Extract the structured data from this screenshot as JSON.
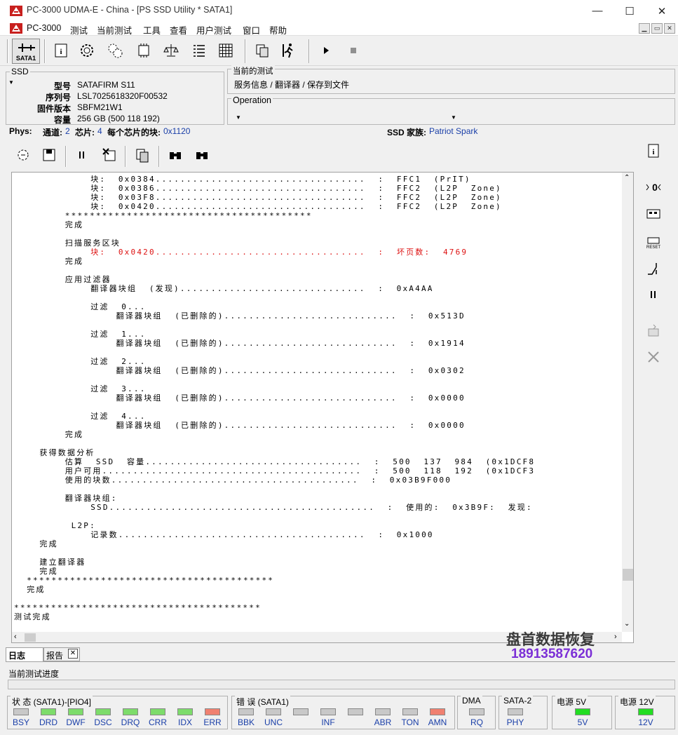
{
  "window": {
    "title": "PC-3000 UDMA-E - China - [PS SSD Utility * SATA1]",
    "minimize": "—",
    "maximize": "☐",
    "close": "✕"
  },
  "menu": {
    "items": [
      "PC-3000",
      "测试",
      "当前测试",
      "工具",
      "查看",
      "用户测试",
      "窗口",
      "帮助"
    ],
    "mdi": [
      "▁",
      "▭",
      "✕"
    ]
  },
  "toolbar": {
    "port_label": "SATA1",
    "icons": [
      "info-icon",
      "cog-icon",
      "cogs-icon",
      "chip-icon",
      "scales-icon",
      "list-icon",
      "grid-icon",
      "copy-icon",
      "walk-icon",
      "play-icon",
      "stop-icon"
    ]
  },
  "ssd": {
    "group_label": "SSD",
    "model_label": "型号",
    "model": "SATAFIRM   S11",
    "serial_label": "序列号",
    "serial": "LSL7025618320F00532",
    "firmware_label": "固件版本",
    "firmware": "SBFM21W1",
    "capacity_label": "容量",
    "capacity": "256 GB (500 118 192)"
  },
  "current_test": {
    "group_label": "当前的测试",
    "path": "服务信息 / 翻译器 / 保存到文件",
    "operation_label": "Operation"
  },
  "phys": {
    "label": "Phys:",
    "channels_label": "通道:",
    "channels": "2",
    "chips_label": "芯片:",
    "chips": "4",
    "blocks_label": "每个芯片的块:",
    "blocks": "0x1120",
    "family_label": "SSD 家族:",
    "family": "Patriot Spark"
  },
  "log": {
    "lines": [
      {
        "i": 6,
        "t": "块:  0x0384..................................  :  FFC1  (PrIT)"
      },
      {
        "i": 6,
        "t": "块:  0x0386..................................  :  FFC2  (L2P  Zone)"
      },
      {
        "i": 6,
        "t": "块:  0x03F8..................................  :  FFC2  (L2P  Zone)"
      },
      {
        "i": 6,
        "t": "块:  0x0420..................................  :  FFC2  (L2P  Zone)"
      },
      {
        "i": 4,
        "t": "****************************************"
      },
      {
        "i": 4,
        "t": "完成"
      },
      {
        "i": 0,
        "t": ""
      },
      {
        "i": 4,
        "t": "扫描服务区块"
      },
      {
        "i": 6,
        "t": "块:  0x0420..................................  :  坏页数:  4769",
        "red": true
      },
      {
        "i": 4,
        "t": "完成"
      },
      {
        "i": 0,
        "t": ""
      },
      {
        "i": 4,
        "t": "应用过滤器"
      },
      {
        "i": 6,
        "t": "翻译器块组  (发现)..............................  :  0xA4AA"
      },
      {
        "i": 0,
        "t": ""
      },
      {
        "i": 6,
        "t": "过滤  0..."
      },
      {
        "i": 8,
        "t": "翻译器块组  (已删除的)............................  :  0x513D"
      },
      {
        "i": 0,
        "t": ""
      },
      {
        "i": 6,
        "t": "过滤  1..."
      },
      {
        "i": 8,
        "t": "翻译器块组  (已删除的)............................  :  0x1914"
      },
      {
        "i": 0,
        "t": ""
      },
      {
        "i": 6,
        "t": "过滤  2..."
      },
      {
        "i": 8,
        "t": "翻译器块组  (已删除的)............................  :  0x0302"
      },
      {
        "i": 0,
        "t": ""
      },
      {
        "i": 6,
        "t": "过滤  3..."
      },
      {
        "i": 8,
        "t": "翻译器块组  (已删除的)............................  :  0x0000"
      },
      {
        "i": 0,
        "t": ""
      },
      {
        "i": 6,
        "t": "过滤  4..."
      },
      {
        "i": 8,
        "t": "翻译器块组  (已删除的)............................  :  0x0000"
      },
      {
        "i": 4,
        "t": "完成"
      },
      {
        "i": 0,
        "t": ""
      },
      {
        "i": 2,
        "t": "获得数据分析"
      },
      {
        "i": 4,
        "t": "估算  SSD  容量...................................  :  500  137  984  (0x1DCF8"
      },
      {
        "i": 4,
        "t": "用户可用..........................................  :  500  118  192  (0x1DCF3"
      },
      {
        "i": 4,
        "t": "使用的块数........................................  :  0x03B9F000"
      },
      {
        "i": 0,
        "t": ""
      },
      {
        "i": 4,
        "t": "翻译器块组:"
      },
      {
        "i": 6,
        "t": "SSD...........................................  :  使用的:  0x3B9F:  发现:"
      },
      {
        "i": 0,
        "t": ""
      },
      {
        "i": 4,
        "t": " L2P:"
      },
      {
        "i": 6,
        "t": "记录数........................................  :  0x1000"
      },
      {
        "i": 2,
        "t": "完成"
      },
      {
        "i": 0,
        "t": ""
      },
      {
        "i": 2,
        "t": "建立翻译器"
      },
      {
        "i": 2,
        "t": "完成"
      },
      {
        "i": 1,
        "t": "****************************************"
      },
      {
        "i": 1,
        "t": "完成"
      },
      {
        "i": 0,
        "t": ""
      },
      {
        "i": 0,
        "t": "****************************************"
      },
      {
        "i": 0,
        "t": "测试完成"
      }
    ]
  },
  "watermark": {
    "name": "盘首数据恢复",
    "phone": "18913587620"
  },
  "tabs": {
    "log": "日志",
    "report": "报告"
  },
  "progress": {
    "label": "当前测试进度"
  },
  "status": {
    "state_title": "状 态 (SATA1)-[PIO4]",
    "state_leds": [
      {
        "name": "BSY",
        "color": "#c8c8c8"
      },
      {
        "name": "DRD",
        "color": "#7ddc6b"
      },
      {
        "name": "DWF",
        "color": "#7ddc6b"
      },
      {
        "name": "DSC",
        "color": "#7ddc6b"
      },
      {
        "name": "DRQ",
        "color": "#7ddc6b"
      },
      {
        "name": "CRR",
        "color": "#7ddc6b"
      },
      {
        "name": "IDX",
        "color": "#7ddc6b"
      },
      {
        "name": "ERR",
        "color": "#f08070"
      }
    ],
    "error_title": "错 误 (SATA1)",
    "error_leds": [
      {
        "name": "BBK",
        "color": "#c8c8c8"
      },
      {
        "name": "UNC",
        "color": "#c8c8c8"
      },
      {
        "name": "",
        "color": "#c8c8c8"
      },
      {
        "name": "INF",
        "color": "#c8c8c8"
      },
      {
        "name": "",
        "color": "#c8c8c8"
      },
      {
        "name": "ABR",
        "color": "#c8c8c8"
      },
      {
        "name": "TON",
        "color": "#c8c8c8"
      },
      {
        "name": "AMN",
        "color": "#f08070"
      }
    ],
    "dma_title": "DMA",
    "dma_led": {
      "name": "RQ",
      "color": "#c8c8c8"
    },
    "sata2_title": "SATA-2",
    "sata2_led": {
      "name": "PHY",
      "color": "#c8c8c8"
    },
    "p5_title": "电源 5V",
    "p5_led": {
      "name": "5V",
      "color": "#22dd22"
    },
    "p12_title": "电源 12V",
    "p12_led": {
      "name": "12V",
      "color": "#22dd22"
    }
  }
}
